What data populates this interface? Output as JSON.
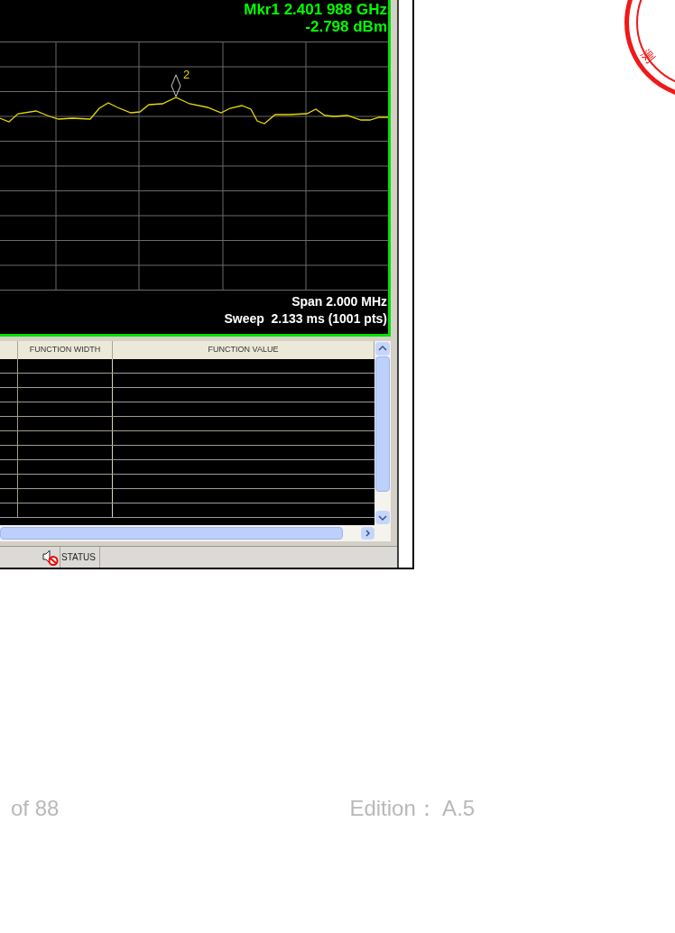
{
  "analyzer": {
    "marker_readout": {
      "frequency": "Mkr1 2.401 988 GHz",
      "level": "-2.798 dBm"
    },
    "trace_marker": {
      "label": "2"
    },
    "span": "Span 2.000 MHz",
    "sweep": "Sweep  2.133 ms (1001 pts)"
  },
  "table": {
    "columns": [
      {
        "label": "FUNCTION WIDTH"
      },
      {
        "label": "FUNCTION VALUE"
      }
    ]
  },
  "status_bar": {
    "sound_muted": true,
    "status": "STATUS"
  },
  "stamp": {
    "text": "测"
  },
  "page_footer": {
    "page": "of 88",
    "edition": "Edition： A.5"
  }
}
